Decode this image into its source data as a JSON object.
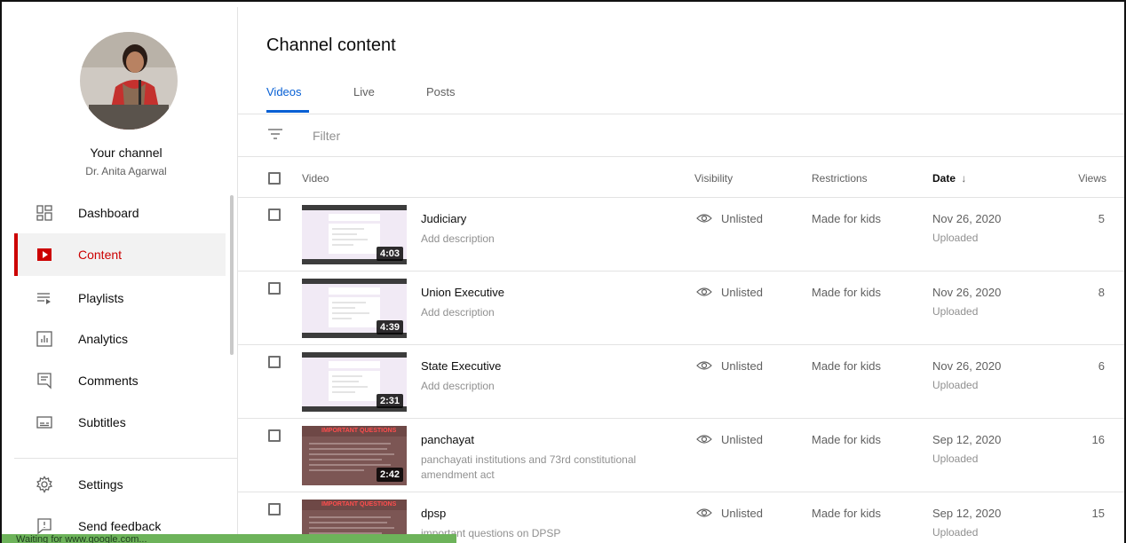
{
  "sidebar": {
    "channel_title": "Your channel",
    "channel_name": "Dr. Anita Agarwal",
    "items": [
      {
        "label": "Dashboard",
        "icon": "dashboard-icon"
      },
      {
        "label": "Content",
        "icon": "content-icon",
        "active": true
      },
      {
        "label": "Playlists",
        "icon": "playlists-icon"
      },
      {
        "label": "Analytics",
        "icon": "analytics-icon"
      },
      {
        "label": "Comments",
        "icon": "comments-icon"
      },
      {
        "label": "Subtitles",
        "icon": "subtitles-icon"
      },
      {
        "label": "Settings",
        "icon": "gear-icon"
      },
      {
        "label": "Send feedback",
        "icon": "feedback-icon"
      }
    ]
  },
  "main": {
    "title": "Channel content",
    "tabs": [
      {
        "label": "Videos",
        "active": true
      },
      {
        "label": "Live"
      },
      {
        "label": "Posts"
      }
    ],
    "filter_placeholder": "Filter",
    "columns": {
      "video": "Video",
      "visibility": "Visibility",
      "restrictions": "Restrictions",
      "date": "Date",
      "views": "Views"
    },
    "rows": [
      {
        "title": "Judiciary",
        "description": "Add description",
        "duration": "4:03",
        "visibility": "Unlisted",
        "restrictions": "Made for kids",
        "date": "Nov 26, 2020",
        "status": "Uploaded",
        "views": "5"
      },
      {
        "title": "Union Executive",
        "description": "Add description",
        "duration": "4:39",
        "visibility": "Unlisted",
        "restrictions": "Made for kids",
        "date": "Nov 26, 2020",
        "status": "Uploaded",
        "views": "8"
      },
      {
        "title": "State Executive",
        "description": "Add description",
        "duration": "2:31",
        "visibility": "Unlisted",
        "restrictions": "Made for kids",
        "date": "Nov 26, 2020",
        "status": "Uploaded",
        "views": "6"
      },
      {
        "title": "panchayat",
        "description": "panchayati institutions and 73rd constitutional amendment act",
        "duration": "2:42",
        "thumb_heading": "IMPORTANT QUESTIONS",
        "visibility": "Unlisted",
        "restrictions": "Made for kids",
        "date": "Sep 12, 2020",
        "status": "Uploaded",
        "views": "16"
      },
      {
        "title": "dpsp",
        "description": "important questions on DPSP",
        "duration": "",
        "thumb_heading": "IMPORTANT QUESTIONS",
        "visibility": "Unlisted",
        "restrictions": "Made for kids",
        "date": "Sep 12, 2020",
        "status": "Uploaded",
        "views": "15"
      }
    ]
  },
  "statusbar": {
    "text": "Waiting for www.google.com..."
  },
  "colors": {
    "accent": "#065fd4",
    "active_nav": "#cc0000",
    "status_bar": "#6db35a"
  }
}
